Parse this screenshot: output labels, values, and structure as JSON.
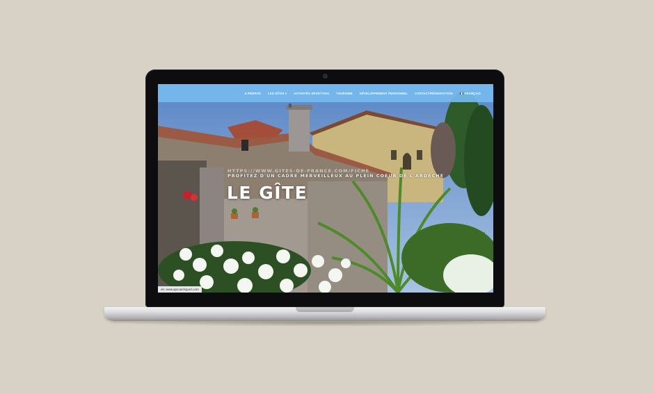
{
  "nav": {
    "items": [
      "A propos",
      "Les Gîtes",
      "Activités sportives",
      "Tourisme",
      "Développement personnel",
      "Contact/Réservation"
    ],
    "language": "Français"
  },
  "hero": {
    "url": "HTTPS://WWW.GITES-DE-FRANCE.COM/FICHE",
    "subtitle": "Profitez d'un cadre merveilleux au plein coeur de l'Ardèche",
    "title": "LE GÎTE"
  },
  "statusbar": {
    "text": "ek: www.apcoachsport.com"
  },
  "colors": {
    "nav": "#76baee",
    "background": "#d8d1c5"
  }
}
